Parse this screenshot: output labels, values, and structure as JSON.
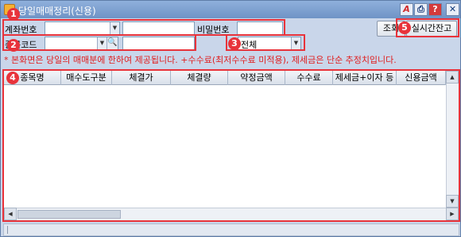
{
  "window": {
    "title": "당일매매정리(신용)"
  },
  "titlebar_buttons": {
    "a": "A",
    "print": "⎙",
    "help": "?",
    "close": "✕"
  },
  "form": {
    "account_label": "계좌번호",
    "password_label": "비밀번호",
    "stock_code_label": "종목코드",
    "filter_value": "전체",
    "search_icon": "🔍"
  },
  "buttons": {
    "query": "조회",
    "realtime": "실시간잔고"
  },
  "notice": "* 본화면은 당일의 매매분에 한하여 제공됩니다.   +수수료(최저수수료 미적용), 제세금은 단순 추정치입니다.",
  "callouts": [
    "1",
    "2",
    "3",
    "4",
    "5"
  ],
  "table": {
    "columns": [
      "종목명",
      "매수도구분",
      "체결가",
      "체결량",
      "약정금액",
      "수수료",
      "제세금+이자 등",
      "신용금액"
    ]
  },
  "colors": {
    "callout": "#e8333b",
    "notice": "#e02020",
    "window_bg": "#c9d6ea"
  }
}
